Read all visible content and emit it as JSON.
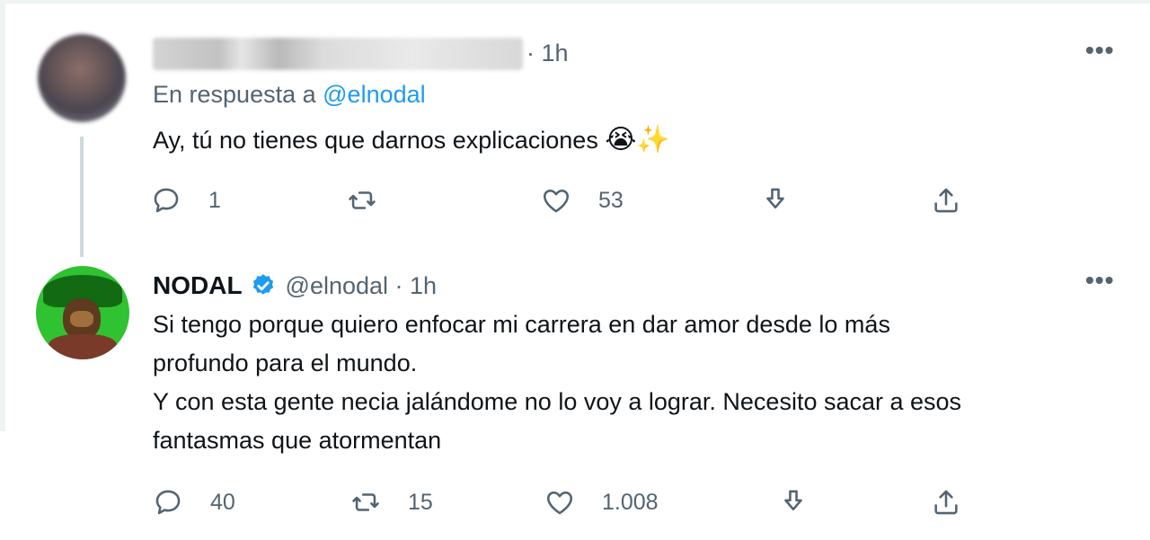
{
  "reply_tweet": {
    "avatar": "user-avatar-blurred",
    "author_name": "",
    "time": "· 1h",
    "reply_prefix": "En respuesta a",
    "reply_handle": "@elnodal",
    "text": "Ay, tú no tienes que darnos explicaciones",
    "emojis": "😭✨",
    "more": "•••",
    "actions": {
      "replies": "1",
      "retweets": "",
      "likes": "53"
    }
  },
  "main_tweet": {
    "avatar": "nodal-avatar",
    "author_name": "NODAL",
    "verified": true,
    "handle_time": "@elnodal · 1h",
    "text_line1": "Si tengo porque quiero enfocar mi carrera en dar amor desde lo más",
    "text_line2": "profundo para el mundo.",
    "text_line3": "Y con esta gente necia jalándome no lo voy a lograr. Necesito sacar a esos",
    "text_line4": "fantasmas que atormentan",
    "more": "•••",
    "actions": {
      "replies": "40",
      "retweets": "15",
      "likes": "1.008"
    }
  },
  "icons": [
    "reply-icon",
    "retweet-icon",
    "like-icon",
    "bookmark-icon",
    "share-icon",
    "verified-badge-icon",
    "more-icon"
  ],
  "colors": {
    "text": "#0f1419",
    "secondary": "#536471",
    "link": "#1d9bf0",
    "verified": "#1d9bf0",
    "thread_line": "#cfd9de"
  }
}
